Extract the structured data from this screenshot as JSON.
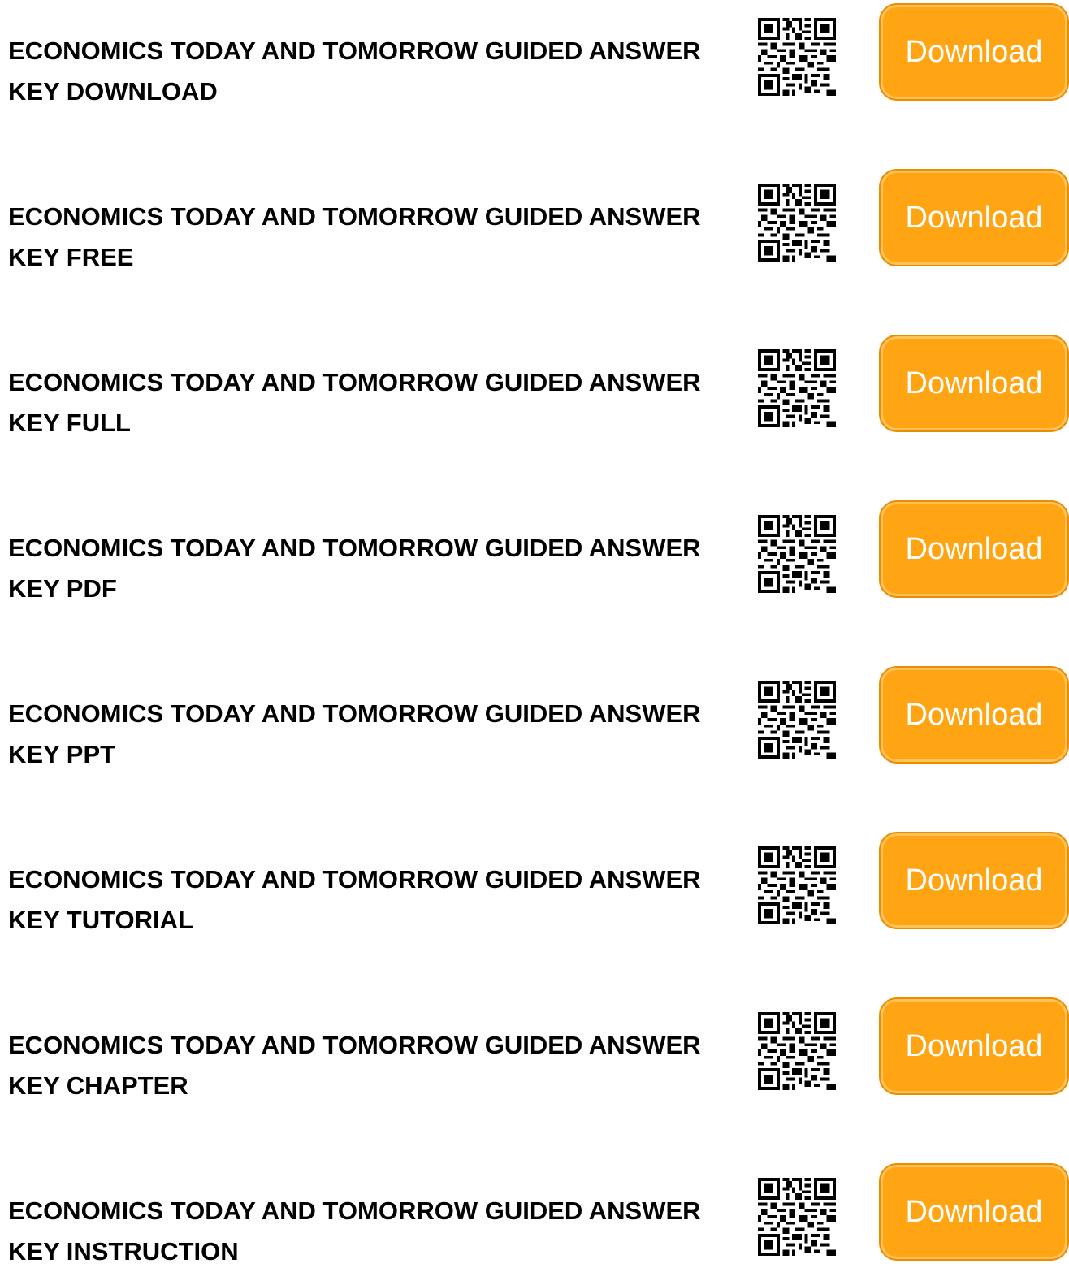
{
  "accent_color": "#ffa514",
  "download_label": "Download",
  "qr_icon": "qr-code-icon",
  "items": [
    {
      "title": "ECONOMICS TODAY AND TOMORROW GUIDED ANSWER KEY DOWNLOAD"
    },
    {
      "title": "ECONOMICS TODAY AND TOMORROW GUIDED ANSWER KEY FREE"
    },
    {
      "title": "ECONOMICS TODAY AND TOMORROW GUIDED ANSWER KEY FULL"
    },
    {
      "title": "ECONOMICS TODAY AND TOMORROW GUIDED ANSWER KEY PDF"
    },
    {
      "title": "ECONOMICS TODAY AND TOMORROW GUIDED ANSWER KEY PPT"
    },
    {
      "title": "ECONOMICS TODAY AND TOMORROW GUIDED ANSWER KEY TUTORIAL"
    },
    {
      "title": "ECONOMICS TODAY AND TOMORROW GUIDED ANSWER KEY CHAPTER"
    },
    {
      "title": "ECONOMICS TODAY AND TOMORROW GUIDED ANSWER KEY INSTRUCTION"
    }
  ]
}
